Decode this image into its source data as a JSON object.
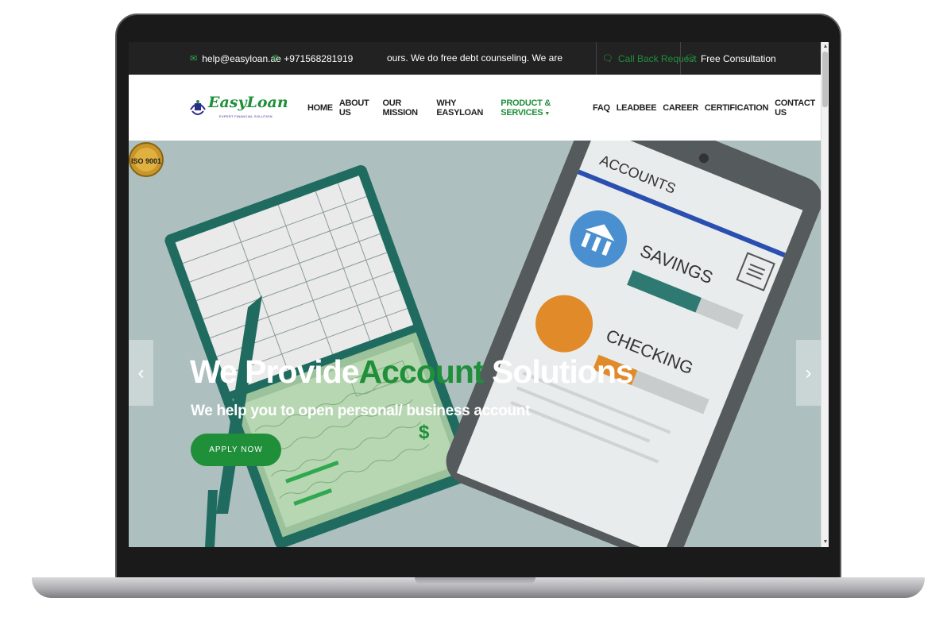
{
  "topbar": {
    "email": "help@easyloan.ae",
    "phone": "+971568281919",
    "ticker": "ours. We do free debt counseling. We are an ISO!",
    "callback_label": "Call Back Request",
    "consultation_label": "Free Consultation"
  },
  "logo": {
    "name": "EasyLoan",
    "tagline": "EXPERT FINANCIAL SOLUTION"
  },
  "nav": {
    "items": [
      {
        "label": "HOME"
      },
      {
        "label": "ABOUT US"
      },
      {
        "label": "OUR MISSION"
      },
      {
        "label": "WHY EASYLOAN"
      },
      {
        "label": "PRODUCT & SERVICES"
      },
      {
        "label": "FAQ"
      },
      {
        "label": "LEADBEE"
      },
      {
        "label": "CAREER"
      },
      {
        "label": "CERTIFICATION"
      },
      {
        "label": "CONTACT US"
      }
    ],
    "active_index": 4
  },
  "hero": {
    "headline_part1": "We Provide",
    "headline_highlight": "Account",
    "headline_part2": " Solutions",
    "subheadline": "We help you to open personal/ business account",
    "cta_label": "APPLY NOW",
    "badge_text": "ISO 9001",
    "illustration": {
      "tablet_title": "ACCOUNTS",
      "row1_label": "SAVINGS",
      "row2_label": "CHECKING",
      "savings_progress": 0.62,
      "checking_progress": 0.35,
      "check_symbol": "$"
    },
    "prev_icon": "chevron-left-icon",
    "next_icon": "chevron-right-icon"
  },
  "colors": {
    "brand_green": "#1f8f3a",
    "topbar_bg": "#222222",
    "hero_bg": "#aebfbf"
  }
}
